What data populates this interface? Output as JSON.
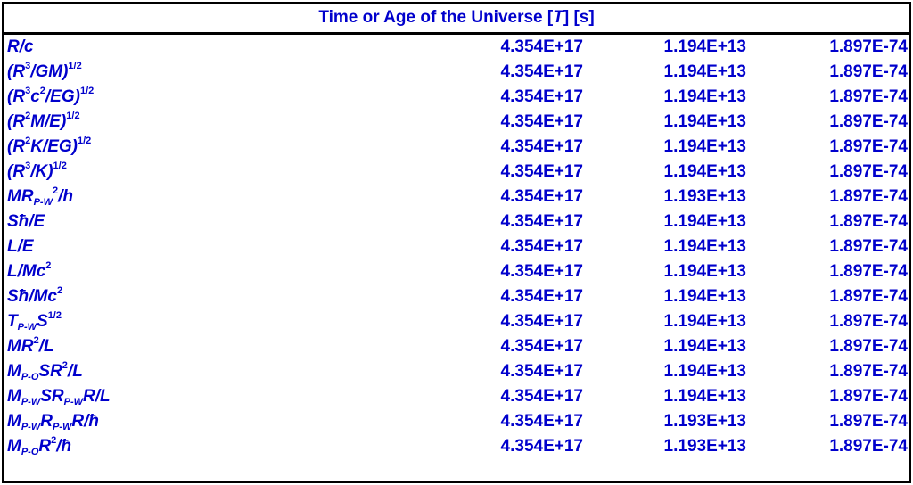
{
  "title": {
    "prefix": "Time or Age of the Universe [",
    "symbol": "T",
    "suffix": "] [s]"
  },
  "rows": [
    {
      "formula_html": "R/c",
      "v1": "4.354E+17",
      "v2": "1.194E+13",
      "v3": "1.897E-74"
    },
    {
      "formula_html": "(R<sup>3</sup>/GM)<sup>1/2</sup>",
      "v1": "4.354E+17",
      "v2": "1.194E+13",
      "v3": "1.897E-74"
    },
    {
      "formula_html": "(R<sup>3</sup>c<sup>2</sup>/EG)<sup>1/2</sup>",
      "v1": "4.354E+17",
      "v2": "1.194E+13",
      "v3": "1.897E-74"
    },
    {
      "formula_html": "(R<sup>2</sup>M/E)<sup>1/2</sup>",
      "v1": "4.354E+17",
      "v2": "1.194E+13",
      "v3": "1.897E-74"
    },
    {
      "formula_html": "(R<sup>2</sup>K/EG)<sup>1/2</sup>",
      "v1": "4.354E+17",
      "v2": "1.194E+13",
      "v3": "1.897E-74"
    },
    {
      "formula_html": "(R<sup>3</sup>/K)<sup>1/2</sup>",
      "v1": "4.354E+17",
      "v2": "1.194E+13",
      "v3": "1.897E-74"
    },
    {
      "formula_html": "MR<sub>P-W</sub><sup>2</sup>/h",
      "v1": "4.354E+17",
      "v2": "1.193E+13",
      "v3": "1.897E-74"
    },
    {
      "formula_html": "Sħ/E",
      "v1": "4.354E+17",
      "v2": "1.194E+13",
      "v3": "1.897E-74"
    },
    {
      "formula_html": "L/E",
      "v1": "4.354E+17",
      "v2": "1.194E+13",
      "v3": "1.897E-74"
    },
    {
      "formula_html": "L/Mc<sup>2</sup>",
      "v1": "4.354E+17",
      "v2": "1.194E+13",
      "v3": "1.897E-74"
    },
    {
      "formula_html": "Sħ/Mc<sup>2</sup>",
      "v1": "4.354E+17",
      "v2": "1.194E+13",
      "v3": "1.897E-74"
    },
    {
      "formula_html": "T<sub>P-W</sub>S<sup>1/2</sup>",
      "v1": "4.354E+17",
      "v2": "1.194E+13",
      "v3": "1.897E-74"
    },
    {
      "formula_html": "MR<sup>2</sup>/L",
      "v1": "4.354E+17",
      "v2": "1.194E+13",
      "v3": "1.897E-74"
    },
    {
      "formula_html": "M<sub>P-O</sub>SR<sup>2</sup>/L",
      "v1": "4.354E+17",
      "v2": "1.194E+13",
      "v3": "1.897E-74"
    },
    {
      "formula_html": "M<sub>P-W</sub>SR<sub>P-W</sub>R/L",
      "v1": "4.354E+17",
      "v2": "1.194E+13",
      "v3": "1.897E-74"
    },
    {
      "formula_html": "M<sub>P-W</sub>R<sub>P-W</sub>R/ħ",
      "v1": "4.354E+17",
      "v2": "1.193E+13",
      "v3": "1.897E-74"
    },
    {
      "formula_html": "M<sub>P-O</sub>R<sup>2</sup>/ħ",
      "v1": "4.354E+17",
      "v2": "1.193E+13",
      "v3": "1.897E-74"
    }
  ],
  "colors": {
    "text": "#0000cc",
    "border": "#000000",
    "background": "#ffffff"
  }
}
